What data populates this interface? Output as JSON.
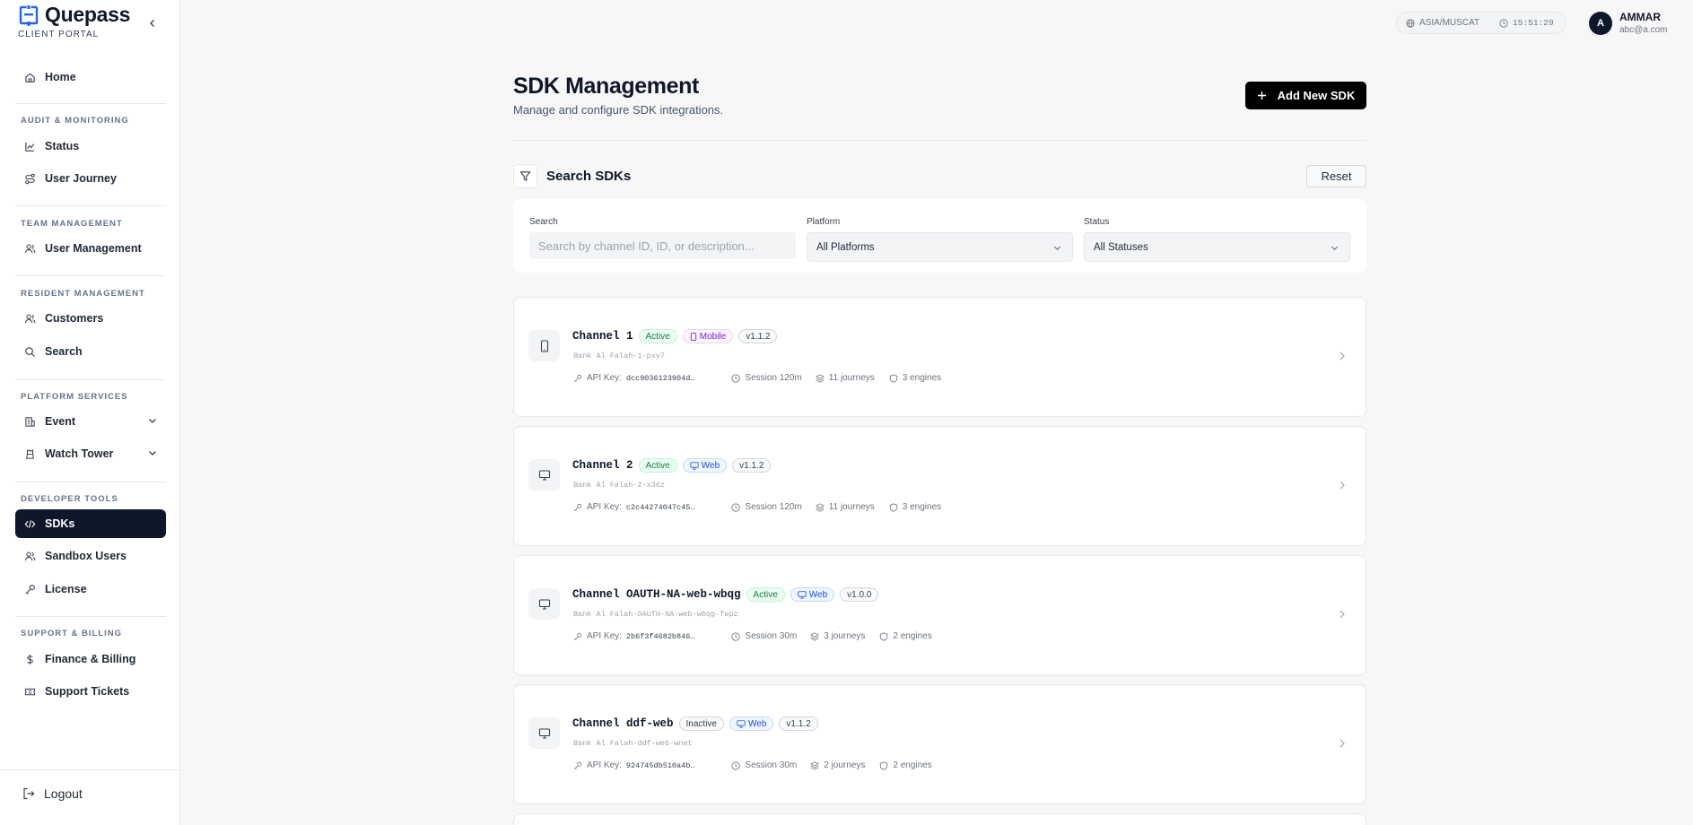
{
  "brand": {
    "name": "Quepass",
    "subtitle": "CLIENT PORTAL"
  },
  "sidebar": {
    "home": "Home",
    "sections": [
      {
        "label": "AUDIT & MONITORING",
        "items": [
          "Status",
          "User Journey"
        ]
      },
      {
        "label": "TEAM MANAGEMENT",
        "items": [
          "User Management"
        ]
      },
      {
        "label": "RESIDENT MANAGEMENT",
        "items": [
          "Customers",
          "Search"
        ]
      },
      {
        "label": "PLATFORM SERVICES",
        "items": [
          "Event",
          "Watch Tower"
        ]
      },
      {
        "label": "DEVELOPER TOOLS",
        "items": [
          "SDKs",
          "Sandbox Users",
          "License"
        ]
      },
      {
        "label": "SUPPORT & BILLING",
        "items": [
          "Finance & Billing",
          "Support Tickets"
        ]
      }
    ],
    "active_item": "SDKs",
    "logout": "Logout"
  },
  "header": {
    "timezone": "ASIA/MUSCAT",
    "time": "15:51:29",
    "user": {
      "initial": "A",
      "name": "AMMAR",
      "email": "abc@a.com"
    }
  },
  "page": {
    "title": "SDK Management",
    "subtitle": "Manage and configure SDK integrations.",
    "add_button": "Add New SDK"
  },
  "filters": {
    "title": "Search SDKs",
    "reset": "Reset",
    "search_label": "Search",
    "search_placeholder": "Search by channel ID, ID, or description...",
    "platform_label": "Platform",
    "platform_value": "All Platforms",
    "status_label": "Status",
    "status_value": "All Statuses"
  },
  "sdks": [
    {
      "name": "Channel 1",
      "status": "Active",
      "platform": "Mobile",
      "version": "v1.1.2",
      "slug": "Bank Al Falah-1-pxy7",
      "api_key_label": "API Key:",
      "api_key": "dcc9036123904d…",
      "session": "Session 120m",
      "journeys": "11 journeys",
      "engines": "3 engines"
    },
    {
      "name": "Channel 2",
      "status": "Active",
      "platform": "Web",
      "version": "v1.1.2",
      "slug": "Bank Al Falah-2-x36z",
      "api_key_label": "API Key:",
      "api_key": "c2c44274047c45…",
      "session": "Session 120m",
      "journeys": "11 journeys",
      "engines": "3 engines"
    },
    {
      "name": "Channel OAUTH-NA-web-wbqg",
      "status": "Active",
      "platform": "Web",
      "version": "v1.0.0",
      "slug": "Bank Al Falah-OAUTH-NA-web-wbqg-fepz",
      "api_key_label": "API Key:",
      "api_key": "2b6f3f4682b846…",
      "session": "Session 30m",
      "journeys": "3 journeys",
      "engines": "2 engines"
    },
    {
      "name": "Channel ddf-web",
      "status": "Inactive",
      "platform": "Web",
      "version": "v1.1.2",
      "slug": "Bank Al Falah-ddf-web-wnet",
      "api_key_label": "API Key:",
      "api_key": "924745db510a4b…",
      "session": "Session 30m",
      "journeys": "2 journeys",
      "engines": "2 engines"
    }
  ],
  "colors": {
    "primary": "#0f172a",
    "active_green": "#15803d",
    "web_blue": "#1d4ed8",
    "mobile_purple": "#7e22ce"
  }
}
